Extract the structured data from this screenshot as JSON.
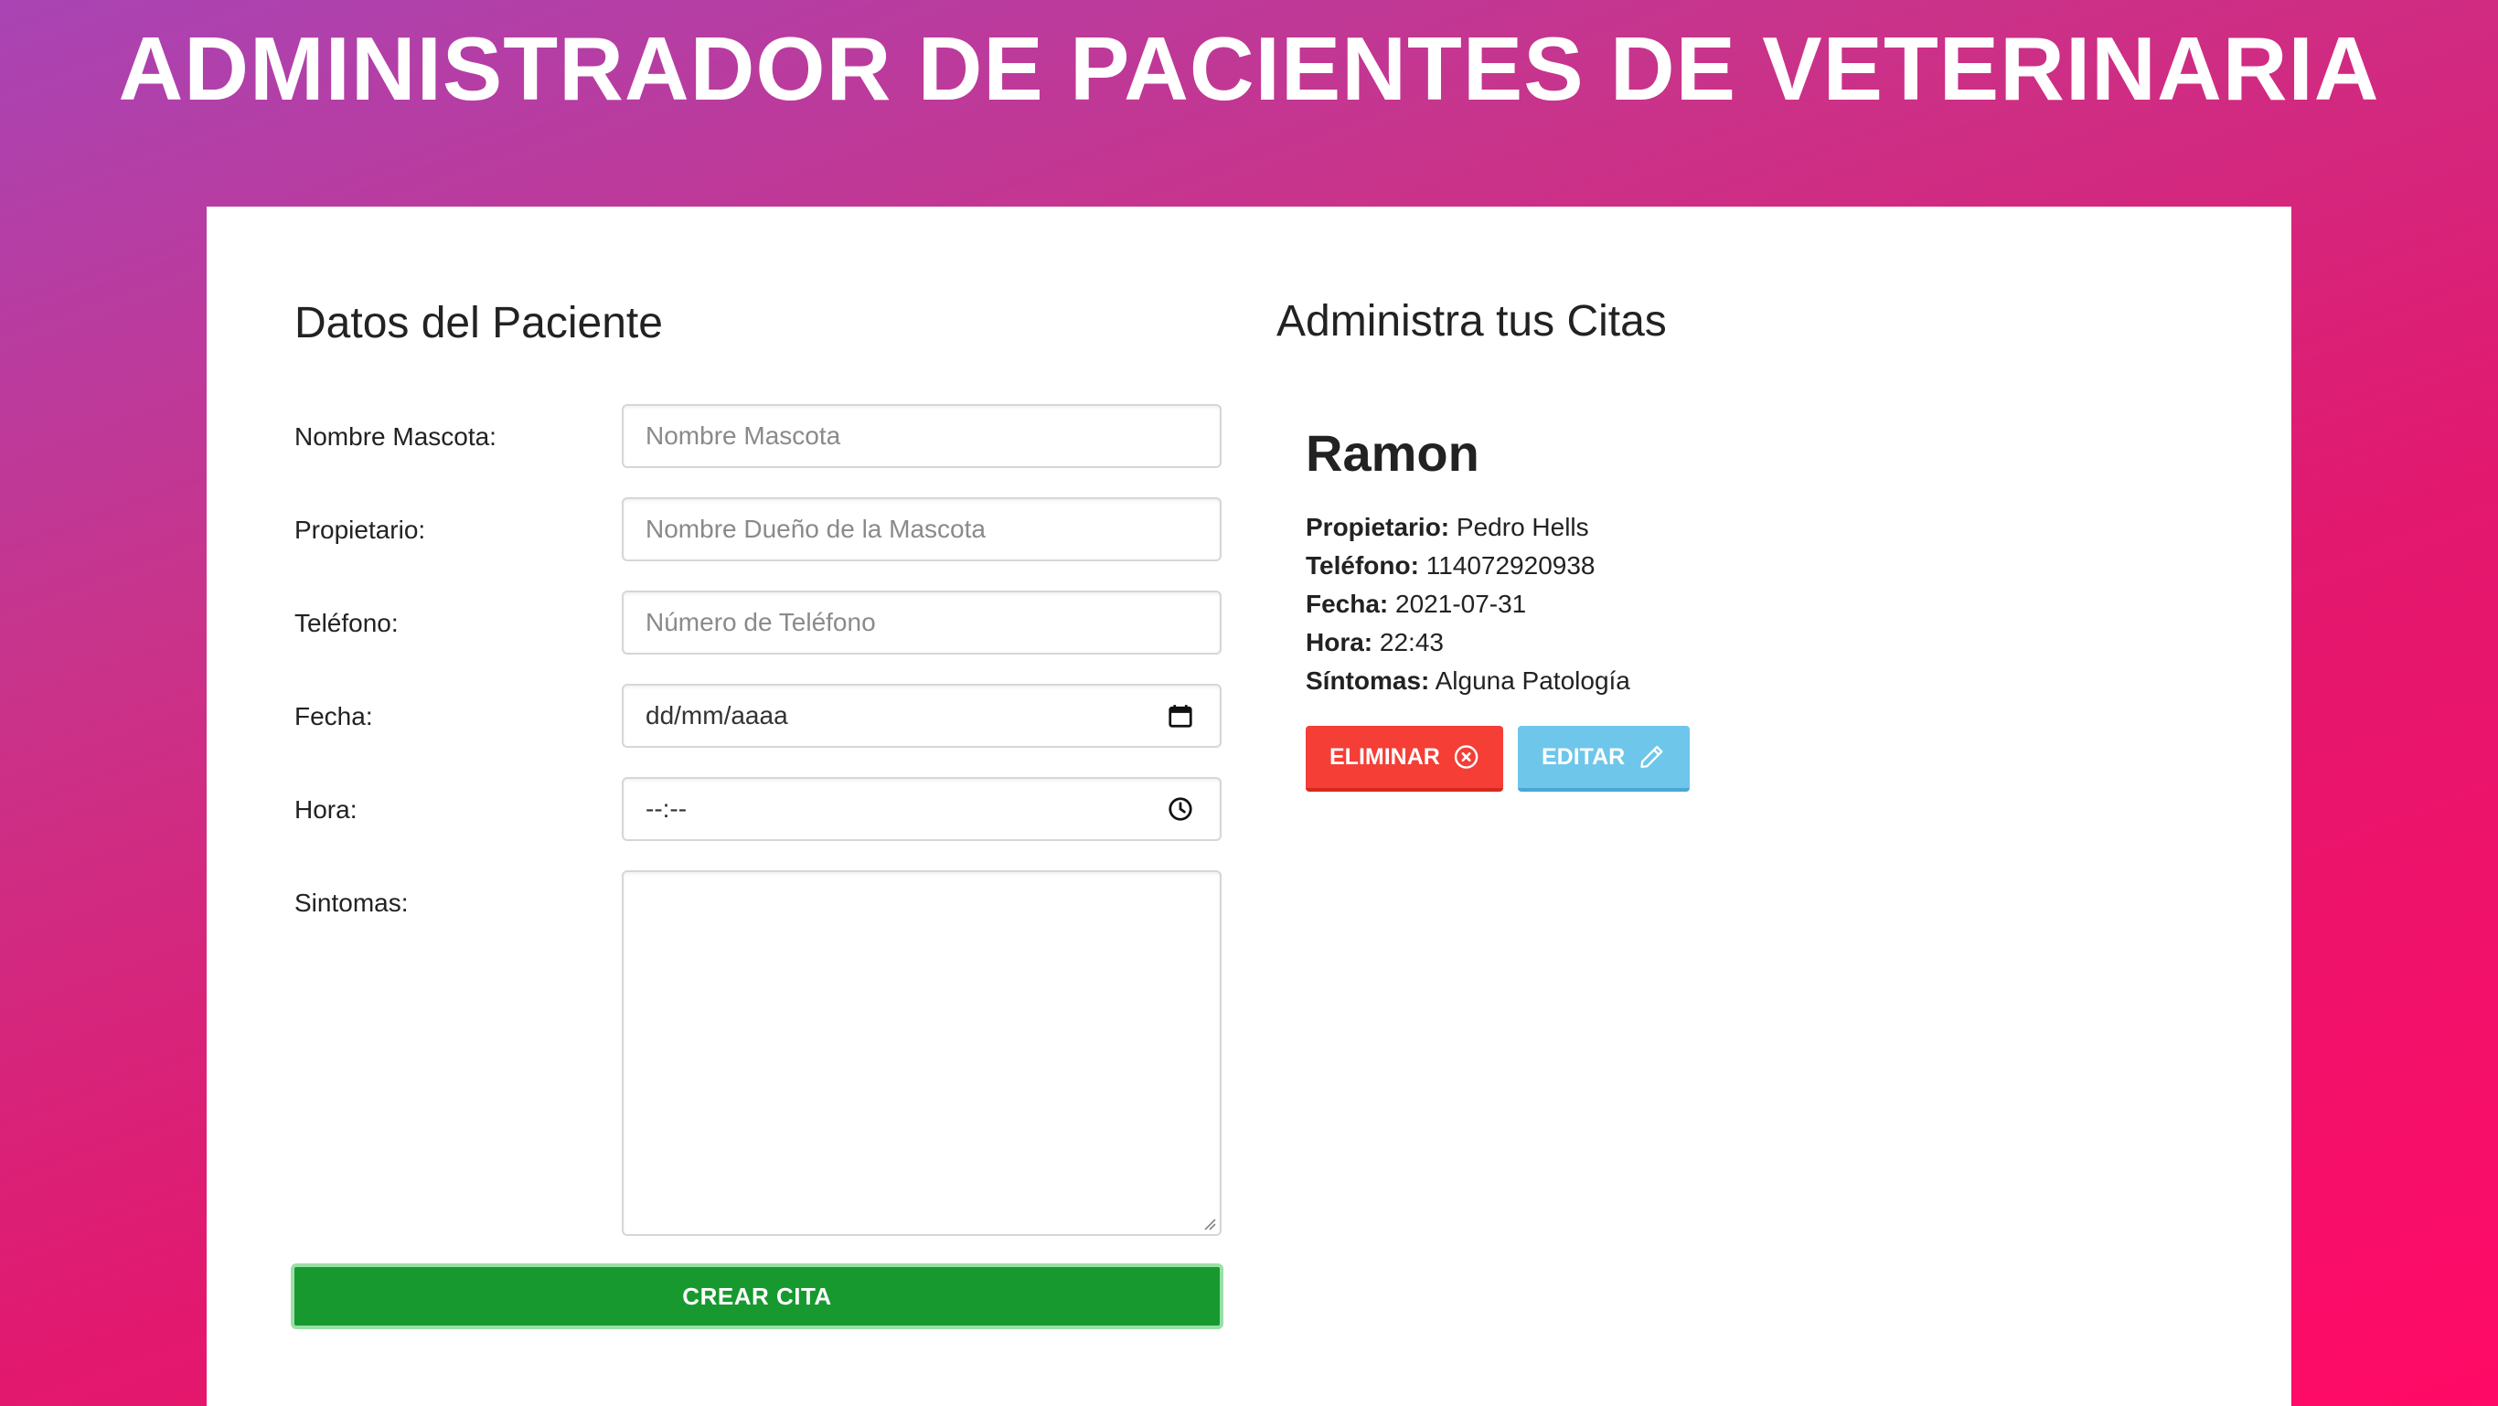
{
  "header": {
    "title": "ADMINISTRADOR DE PACIENTES DE VETERINARIA"
  },
  "form": {
    "title": "Datos del Paciente",
    "fields": {
      "pet_name": {
        "label": "Nombre Mascota:",
        "placeholder": "Nombre Mascota"
      },
      "owner": {
        "label": "Propietario:",
        "placeholder": "Nombre Dueño de la Mascota"
      },
      "phone": {
        "label": "Teléfono:",
        "placeholder": "Número de Teléfono"
      },
      "date": {
        "label": "Fecha:",
        "value": "dd/mm/aaaa",
        "icon": "calendar-icon"
      },
      "time": {
        "label": "Hora:",
        "value": "--:--",
        "icon": "clock-icon"
      },
      "symptoms": {
        "label": "Sintomas:",
        "value": ""
      }
    },
    "submit_label": "CREAR CITA"
  },
  "appointments": {
    "title": "Administra tus Citas",
    "items": [
      {
        "name": "Ramon",
        "owner_label": "Propietario:",
        "owner": "Pedro Hells",
        "phone_label": "Teléfono:",
        "phone": "114072920938",
        "date_label": "Fecha:",
        "date": "2021-07-31",
        "time_label": "Hora:",
        "time": "22:43",
        "symptoms_label": "Síntomas:",
        "symptoms": "Alguna Patología",
        "delete_label": "ELIMINAR",
        "edit_label": "EDITAR"
      }
    ]
  },
  "colors": {
    "submit": "#17992f",
    "delete": "#f43e36",
    "edit": "#6ec6ea",
    "gradient_start": "#a944b4",
    "gradient_end": "#ff0a66"
  }
}
